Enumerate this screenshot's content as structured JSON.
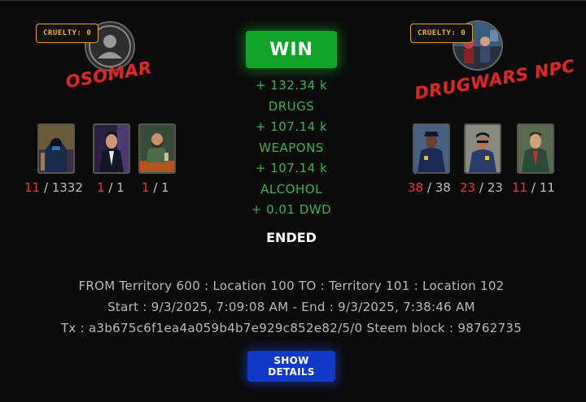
{
  "colors": {
    "background": "#0b0b0c",
    "win": "#10a52a",
    "reward_text": "#3ab04a",
    "player_name": "#d42a2a",
    "cruelty_border": "#e0a028",
    "details_button": "#1238c8",
    "count_current": "#e03a3a"
  },
  "attacker": {
    "cruelty_label": "CRUELTY: 0",
    "name": "OSOMAR",
    "avatar_icon": "default-user-icon",
    "units": [
      {
        "icon": "hooded-thug-icon",
        "current": "11",
        "total": "1332"
      },
      {
        "icon": "suit-gangster-icon",
        "current": "1",
        "total": "1"
      },
      {
        "icon": "bartender-icon",
        "current": "1",
        "total": "1"
      }
    ]
  },
  "defender": {
    "cruelty_label": "CRUELTY: 0",
    "name": "DRUGWARS NPC",
    "avatar_icon": "npc-gang-portrait-icon",
    "units": [
      {
        "icon": "police-officer-icon",
        "current": "38",
        "total": "38"
      },
      {
        "icon": "policewoman-icon",
        "current": "23",
        "total": "23"
      },
      {
        "icon": "sheriff-icon",
        "current": "11",
        "total": "11"
      }
    ]
  },
  "result": {
    "label": "WIN",
    "status": "ENDED",
    "rewards": [
      "+ 132.34 k",
      "DRUGS",
      "+ 107.14 k",
      "WEAPONS",
      "+ 107.14 k",
      "ALCOHOL",
      "+ 0.01 DWD"
    ]
  },
  "info": {
    "route": "FROM Territory 600 : Location 100 TO : Territory 101 : Location 102",
    "time": "Start : 9/3/2025, 7:09:08 AM - End : 9/3/2025, 7:38:46 AM",
    "tx": "Tx : a3b675c6f1ea4a059b4b7e929c852e82/5/0 Steem block : 98762735"
  },
  "buttons": {
    "details": "SHOW DETAILS"
  }
}
